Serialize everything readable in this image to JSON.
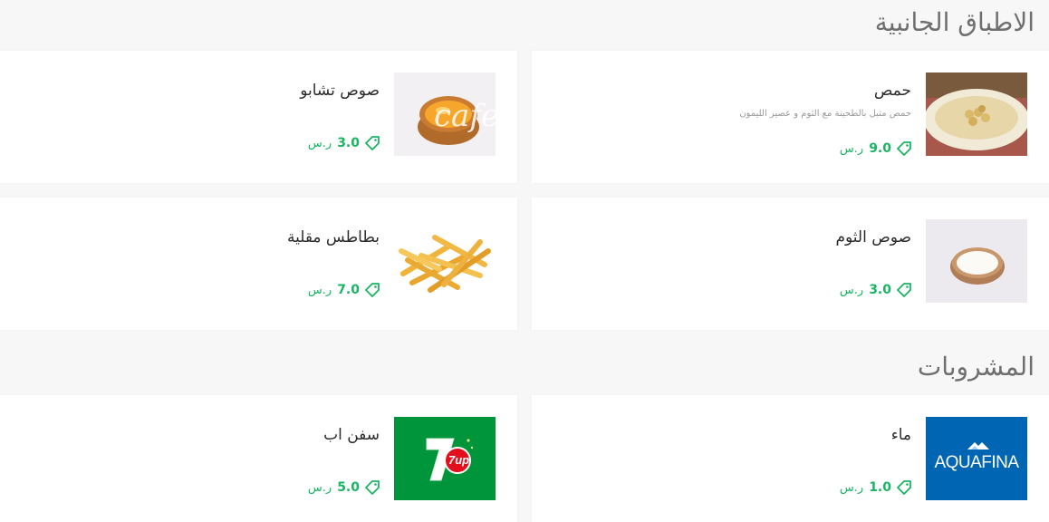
{
  "sections": [
    {
      "title": "الاطباق الجانبية",
      "items": [
        {
          "name": "حمص",
          "description": "حمص متبل بالطحينة مع الثوم و عصير الليمون",
          "price": "9.0",
          "currency": "ر.س",
          "image_icon": "hummus-plate"
        },
        {
          "name": "صوص تشابو",
          "description": "",
          "price": "3.0",
          "currency": "ر.س",
          "image_icon": "sauce-bowl"
        },
        {
          "name": "صوص الثوم",
          "description": "",
          "price": "3.0",
          "currency": "ر.س",
          "image_icon": "garlic-sauce-bowl"
        },
        {
          "name": "بطاطس مقلية",
          "description": "",
          "price": "7.0",
          "currency": "ر.س",
          "image_icon": "french-fries"
        }
      ]
    },
    {
      "title": "المشروبات",
      "items": [
        {
          "name": "ماء",
          "description": "",
          "price": "1.0",
          "currency": "ر.س",
          "image_icon": "aquafina-logo",
          "logo_text": "AQUAFINA"
        },
        {
          "name": "سفن اب",
          "description": "",
          "price": "5.0",
          "currency": "ر.س",
          "image_icon": "7up-logo",
          "logo_text": "7up"
        }
      ]
    }
  ],
  "watermark": "cafe",
  "colors": {
    "price": "#19b563",
    "title": "#6f6f6f",
    "card": "#ffffff",
    "background": "#f7f7f7",
    "aquafina_bg": "#0066b3",
    "sevenup_bg": "#00953a"
  }
}
